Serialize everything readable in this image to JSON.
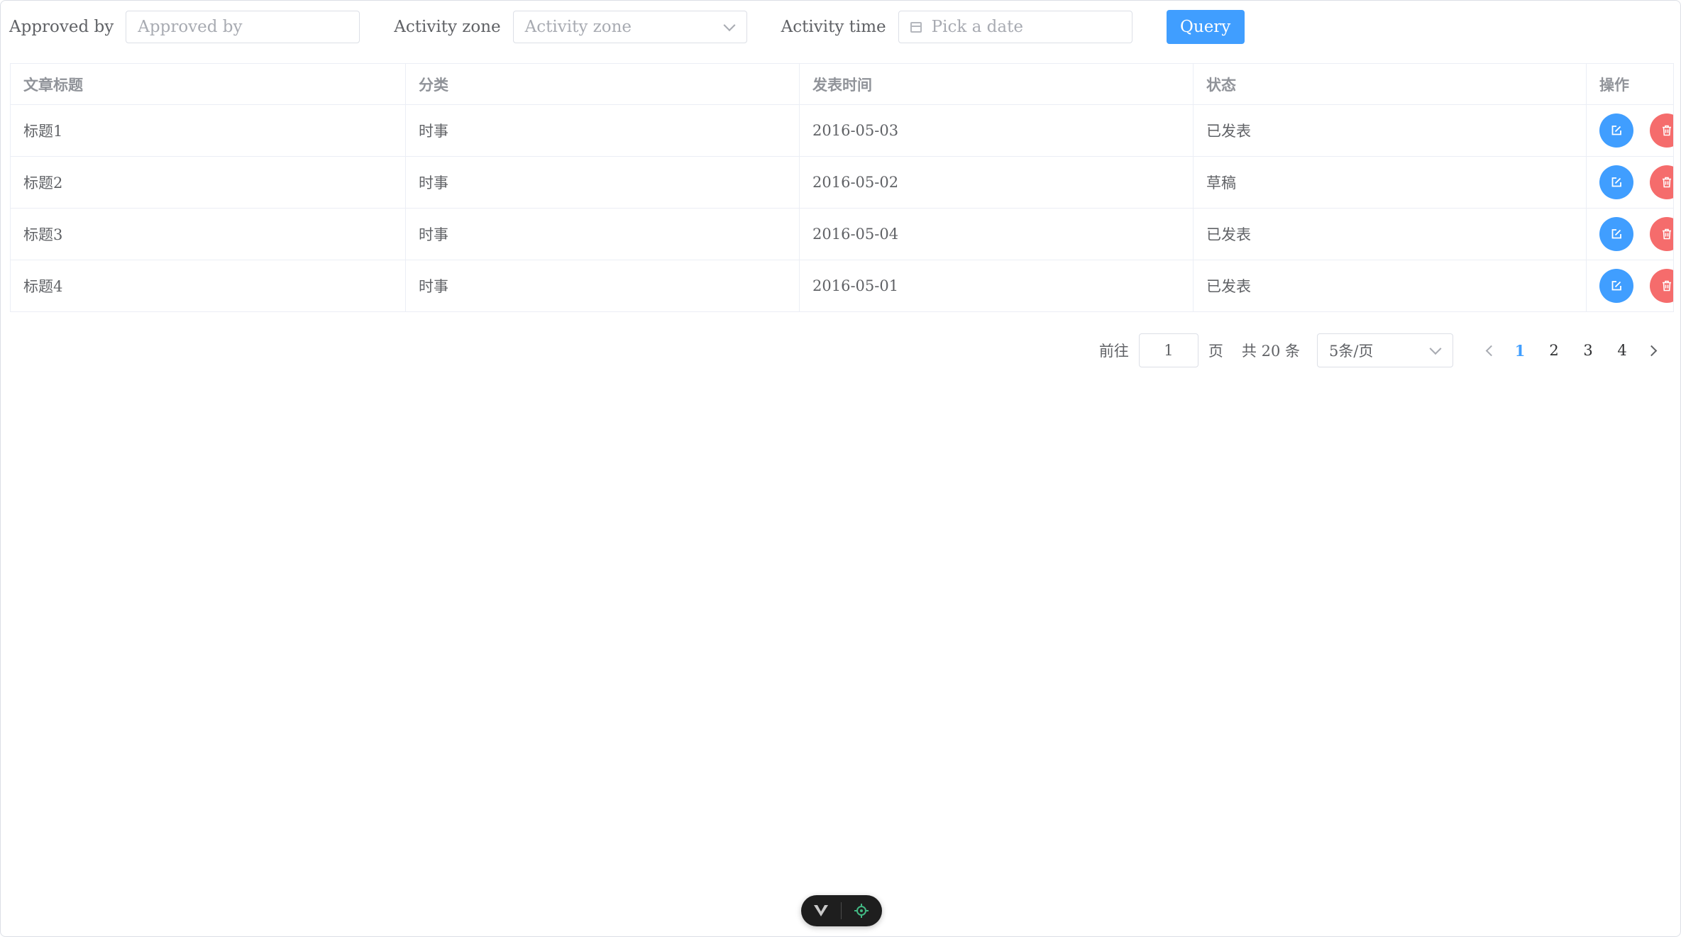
{
  "filters": {
    "approved_by": {
      "label": "Approved by",
      "placeholder": "Approved by",
      "value": ""
    },
    "activity_zone": {
      "label": "Activity zone",
      "placeholder": "Activity zone"
    },
    "activity_time": {
      "label": "Activity time",
      "placeholder": "Pick a date"
    },
    "query_label": "Query"
  },
  "table": {
    "columns": [
      "文章标题",
      "分类",
      "发表时间",
      "状态",
      "操作"
    ],
    "rows": [
      {
        "title": "标题1",
        "category": "时事",
        "date": "2016-05-03",
        "status": "已发表"
      },
      {
        "title": "标题2",
        "category": "时事",
        "date": "2016-05-02",
        "status": "草稿"
      },
      {
        "title": "标题3",
        "category": "时事",
        "date": "2016-05-04",
        "status": "已发表"
      },
      {
        "title": "标题4",
        "category": "时事",
        "date": "2016-05-01",
        "status": "已发表"
      }
    ],
    "actions": {
      "edit_icon": "edit-icon",
      "delete_icon": "trash-icon"
    }
  },
  "pagination": {
    "goto_prefix": "前往",
    "goto_value": "1",
    "goto_suffix": "页",
    "total_text": "共 20 条",
    "page_size": "5条/页",
    "pages": [
      "1",
      "2",
      "3",
      "4"
    ],
    "current_page": "1"
  },
  "colors": {
    "primary": "#409eff",
    "danger": "#f56c6c",
    "devtools_accent": "#42b883"
  }
}
